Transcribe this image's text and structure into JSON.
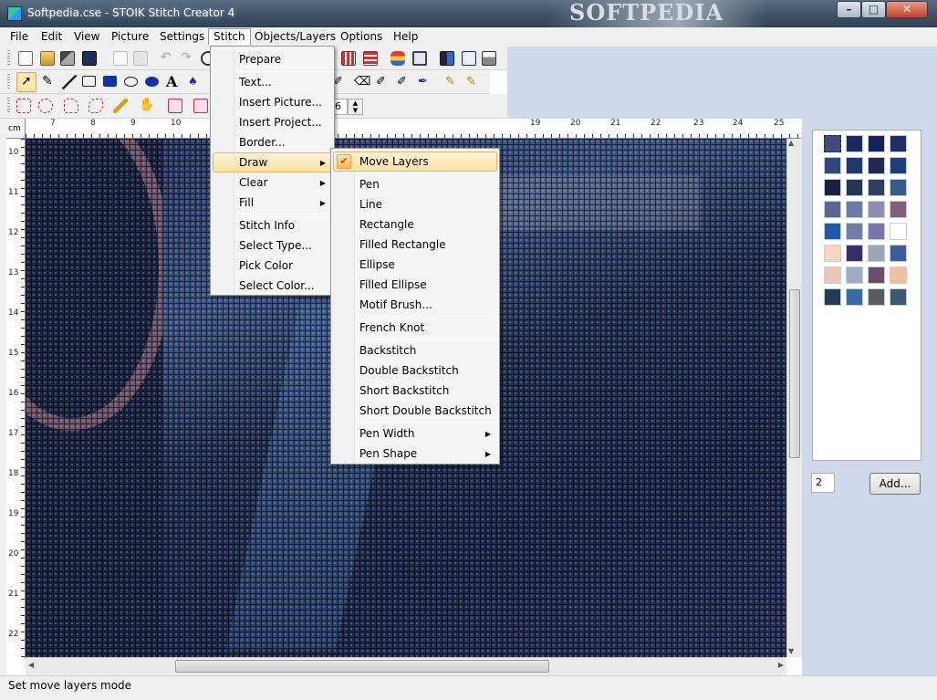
{
  "window": {
    "title": "Softpedia.cse - STOIK Stitch Creator 4",
    "watermark": "SOFTPEDIA",
    "minimize_glyph": "–",
    "maximize_glyph": "□",
    "close_glyph": "✕"
  },
  "menubar": {
    "items": [
      "File",
      "Edit",
      "View",
      "Picture",
      "Settings",
      "Stitch",
      "Objects/Layers",
      "Options",
      "Help"
    ],
    "active": "Stitch"
  },
  "toolbar": {
    "zoom_value": "6"
  },
  "rulers": {
    "unit": "cm",
    "top_ticks": [
      "7",
      "8",
      "9",
      "10",
      "19",
      "20",
      "21",
      "22",
      "23",
      "24",
      "25"
    ],
    "left_ticks": [
      "10",
      "11",
      "12",
      "13",
      "14",
      "15",
      "16",
      "17",
      "18",
      "19",
      "20",
      "21",
      "22"
    ]
  },
  "stitch_menu": {
    "items": [
      "Prepare",
      "Text...",
      "Insert Picture...",
      "Insert Project...",
      "Border...",
      "Draw",
      "Clear",
      "Fill",
      "Stitch Info",
      "Select Type...",
      "Pick Color",
      "Select Color..."
    ],
    "highlighted": "Draw"
  },
  "draw_menu": {
    "items": [
      "Move Layers",
      "Pen",
      "Line",
      "Rectangle",
      "Filled Rectangle",
      "Ellipse",
      "Filled Ellipse",
      "Motif Brush...",
      "French Knot",
      "Backstitch",
      "Double Backstitch",
      "Short Backstitch",
      "Short Double Backstitch",
      "Pen Width",
      "Pen Shape"
    ],
    "checked": "Move Layers"
  },
  "palette": {
    "colors": [
      "#3e4c7e",
      "#1b2a5e",
      "#17215a",
      "#1f2c66",
      "#30487f",
      "#20386c",
      "#1f2b53",
      "#1f3f78",
      "#1a2040",
      "#223656",
      "#2e3e5e",
      "#3a5a8c",
      "#5b6690",
      "#6c7aa6",
      "#8b8fb2",
      "#825f7c",
      "#1e5aa6",
      "#6f7fa6",
      "#7c74b0",
      "#ffffff",
      "#f5d5bf",
      "#3a2e6a",
      "#9aa6b8",
      "#3d5c9c",
      "#e8c6b8",
      "#9fa9c8",
      "#6b4e6e",
      "#f4c0a4",
      "#243a5a",
      "#3a6aa4",
      "#5a5a62",
      "#3c5870"
    ],
    "count_value": "2",
    "add_label": "Add..."
  },
  "status": {
    "text": "Set move layers mode"
  }
}
